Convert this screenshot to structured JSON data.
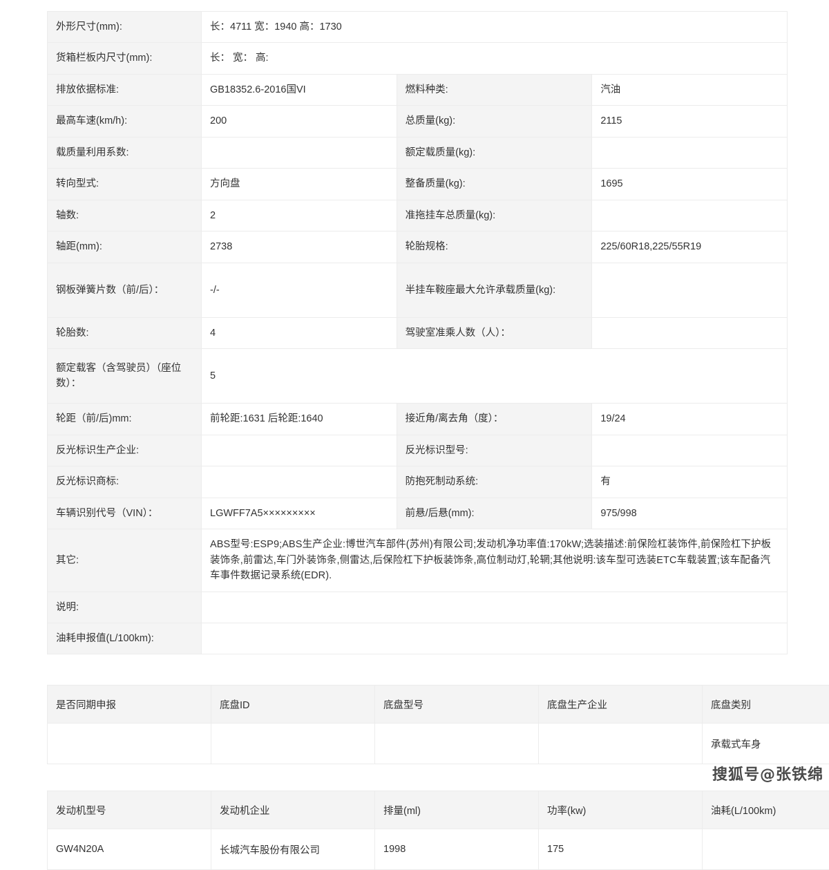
{
  "spec_table": {
    "rows": [
      {
        "label": "外形尺寸(mm):",
        "value": "长：4711 宽：1940 高：1730",
        "full_width": true
      },
      {
        "label": "货箱栏板内尺寸(mm):",
        "value": "长： 宽： 高:",
        "full_width": true
      },
      {
        "label": "排放依据标准:",
        "value": "GB18352.6-2016国VI",
        "label2": "燃料种类:",
        "value2": "汽油"
      },
      {
        "label": "最高车速(km/h):",
        "value": "200",
        "label2": "总质量(kg):",
        "value2": "2115"
      },
      {
        "label": "载质量利用系数:",
        "value": "",
        "label2": "额定载质量(kg):",
        "value2": ""
      },
      {
        "label": "转向型式:",
        "value": "方向盘",
        "label2": "整备质量(kg):",
        "value2": "1695"
      },
      {
        "label": "轴数:",
        "value": "2",
        "label2": "准拖挂车总质量(kg):",
        "value2": ""
      },
      {
        "label": "轴距(mm):",
        "value": "2738",
        "label2": "轮胎规格:",
        "value2": "225/60R18,225/55R19"
      },
      {
        "label": "钢板弹簧片数（前/后）：",
        "value": "-/-",
        "label2": "半挂车鞍座最大允许承载质量(kg):",
        "value2": "",
        "tall": true
      },
      {
        "label": "轮胎数:",
        "value": "4",
        "label2": "驾驶室准乘人数（人）：",
        "value2": ""
      },
      {
        "label": "额定载客（含驾驶员）（座位数）：",
        "value": "5",
        "full_width": true,
        "tall": true
      },
      {
        "label": "轮距（前/后)mm:",
        "value": "前轮距:1631 后轮距:1640",
        "label2": "接近角/离去角（度）：",
        "value2": "19/24"
      },
      {
        "label": "反光标识生产企业:",
        "value": "",
        "label2": "反光标识型号:",
        "value2": ""
      },
      {
        "label": "反光标识商标:",
        "value": "",
        "label2": "防抱死制动系统:",
        "value2": "有"
      },
      {
        "label": "车辆识别代号（VIN）：",
        "value": "LGWFF7A5×××××××××",
        "label2": "前悬/后悬(mm):",
        "value2": "975/998"
      },
      {
        "label": "其它:",
        "value": "ABS型号:ESP9;ABS生产企业:博世汽车部件(苏州)有限公司;发动机净功率值:170kW;选装描述:前保险杠装饰件,前保险杠下护板装饰条,前雷达,车门外装饰条,侧雷达,后保险杠下护板装饰条,高位制动灯,轮辋;其他说明:该车型可选装ETC车载装置;该车配备汽车事件数据记录系统(EDR).",
        "full_width": true,
        "other": true
      },
      {
        "label": "说明:",
        "value": "",
        "full_width": true
      },
      {
        "label": "油耗申报值(L/100km):",
        "value": "",
        "full_width": true
      }
    ]
  },
  "chassis_table": {
    "headers": [
      "是否同期申报",
      "底盘ID",
      "底盘型号",
      "底盘生产企业",
      "底盘类别"
    ],
    "rows": [
      [
        "",
        "",
        "",
        "",
        "承载式车身"
      ]
    ]
  },
  "engine_table": {
    "headers": [
      "发动机型号",
      "发动机企业",
      "排量(ml)",
      "功率(kw)",
      "油耗(L/100km)"
    ],
    "rows": [
      [
        "GW4N20A",
        "长城汽车股份有限公司",
        "1998",
        "175",
        ""
      ]
    ]
  },
  "watermark": {
    "text": "搜狐号@张铁绵"
  },
  "colors": {
    "label_bg": "#f4f4f4",
    "border": "#ececec",
    "text": "#333333",
    "page_bg": "#ffffff"
  }
}
